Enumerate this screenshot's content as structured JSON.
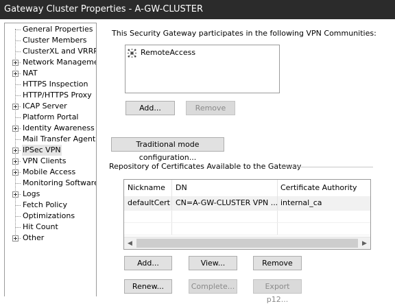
{
  "window": {
    "title": "Gateway Cluster Properties - A-GW-CLUSTER"
  },
  "sidebar": {
    "items": [
      {
        "label": "General Properties",
        "expandable": false,
        "selected": false
      },
      {
        "label": "Cluster Members",
        "expandable": false,
        "selected": false
      },
      {
        "label": "ClusterXL and VRRP",
        "expandable": false,
        "selected": false
      },
      {
        "label": "Network Management",
        "expandable": true,
        "selected": false
      },
      {
        "label": "NAT",
        "expandable": true,
        "selected": false
      },
      {
        "label": "HTTPS Inspection",
        "expandable": false,
        "selected": false
      },
      {
        "label": "HTTP/HTTPS Proxy",
        "expandable": false,
        "selected": false
      },
      {
        "label": "ICAP Server",
        "expandable": true,
        "selected": false
      },
      {
        "label": "Platform Portal",
        "expandable": false,
        "selected": false
      },
      {
        "label": "Identity Awareness",
        "expandable": true,
        "selected": false
      },
      {
        "label": "Mail Transfer Agent",
        "expandable": false,
        "selected": false
      },
      {
        "label": "IPSec VPN",
        "expandable": true,
        "selected": true
      },
      {
        "label": "VPN Clients",
        "expandable": true,
        "selected": false
      },
      {
        "label": "Mobile Access",
        "expandable": true,
        "selected": false
      },
      {
        "label": "Monitoring Software bla",
        "expandable": false,
        "selected": false
      },
      {
        "label": "Logs",
        "expandable": true,
        "selected": false
      },
      {
        "label": "Fetch Policy",
        "expandable": false,
        "selected": false
      },
      {
        "label": "Optimizations",
        "expandable": false,
        "selected": false
      },
      {
        "label": "Hit Count",
        "expandable": false,
        "selected": false
      },
      {
        "label": "Other",
        "expandable": true,
        "selected": false
      }
    ]
  },
  "communities": {
    "description": "This Security Gateway participates in the following VPN Communities:",
    "items": [
      {
        "label": "RemoteAccess",
        "icon": "remote-access-community-icon"
      }
    ],
    "add_label": "Add...",
    "remove_label": "Remove"
  },
  "traditional_mode": {
    "label": "Traditional mode configuration..."
  },
  "certificates": {
    "group_title": "Repository of Certificates Available to the Gateway",
    "columns": [
      "Nickname",
      "DN",
      "Certificate Authority"
    ],
    "rows": [
      {
        "nickname": "defaultCert",
        "dn": "CN=A-GW-CLUSTER VPN ...",
        "ca": "internal_ca"
      }
    ],
    "buttons": {
      "add": "Add...",
      "view": "View...",
      "remove": "Remove",
      "renew": "Renew...",
      "complete": "Complete...",
      "export": "Export p12..."
    },
    "scroll_left": "◀",
    "scroll_right": "▶"
  }
}
